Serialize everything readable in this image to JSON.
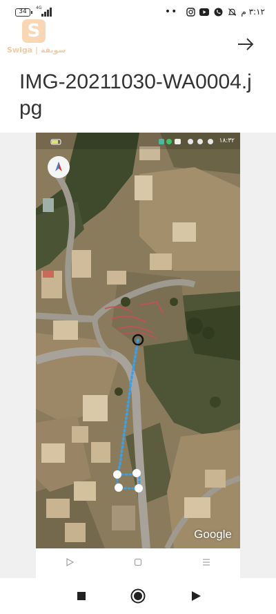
{
  "status_bar": {
    "battery": "34",
    "network": "4G",
    "time": "٣:١٢ م",
    "icons": [
      "instagram-icon",
      "youtube-icon",
      "whatsapp-icon",
      "bell-muted-icon"
    ]
  },
  "logo": {
    "letter": "S",
    "text": "Swiga | سويقة"
  },
  "header": {
    "title": "IMG-20211030-WA0004.jpg",
    "forward_icon": "arrow-right-icon"
  },
  "image": {
    "watermark": "Google",
    "inner_status_time": "١٨:٣٢"
  },
  "bottom_nav": {
    "buttons": [
      "stop-icon",
      "record-icon",
      "play-icon"
    ]
  },
  "colors": {
    "accent_logo": "#f3a65a",
    "route_dots": "#3aa0e8",
    "text": "#333333"
  }
}
